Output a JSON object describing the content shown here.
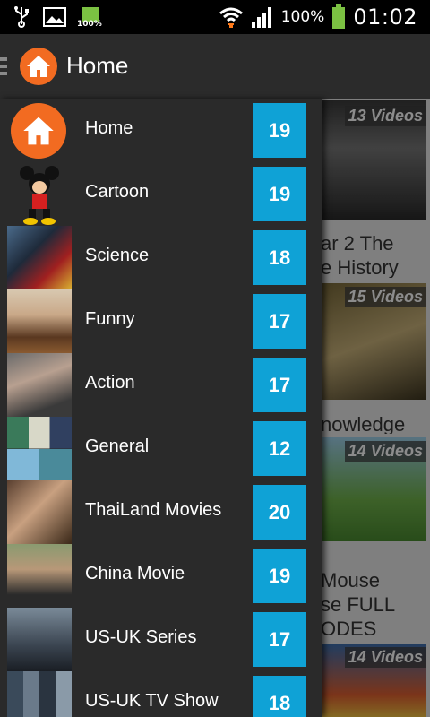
{
  "status_bar": {
    "battery_percent": "100%",
    "battery_small_label": "100%",
    "time": "01:02",
    "icons": [
      "usb-icon",
      "image-icon",
      "battery-small-icon",
      "wifi-icon",
      "signal-icon",
      "battery-icon"
    ]
  },
  "action_bar": {
    "title": "Home",
    "icon": "home-icon"
  },
  "drawer": {
    "items": [
      {
        "label": "Home",
        "count": "19"
      },
      {
        "label": "Cartoon",
        "count": "19"
      },
      {
        "label": "Science",
        "count": "18"
      },
      {
        "label": "Funny",
        "count": "17"
      },
      {
        "label": "Action",
        "count": "17"
      },
      {
        "label": "General",
        "count": "12"
      },
      {
        "label": "ThaiLand Movies",
        "count": "20"
      },
      {
        "label": "China Movie",
        "count": "19"
      },
      {
        "label": "US-UK Series",
        "count": "17"
      },
      {
        "label": "US-UK TV Show",
        "count": "18"
      }
    ]
  },
  "background_videos": [
    {
      "count": "13 Videos",
      "title_line1": "ar 2 The",
      "title_line2": "e History"
    },
    {
      "count": "15 Videos",
      "title_line1": "nowledge",
      "title_line2": ""
    },
    {
      "count": "14 Videos",
      "title_line1": "Mouse",
      "title_line2": "se FULL",
      "title_line3": "ODES"
    },
    {
      "count": "14 Videos"
    }
  ],
  "colors": {
    "accent_badge": "#0fa2d6",
    "home_orange": "#f26b21",
    "drawer_bg": "#2a2a2a",
    "action_bar_bg": "#2b2b2b"
  }
}
